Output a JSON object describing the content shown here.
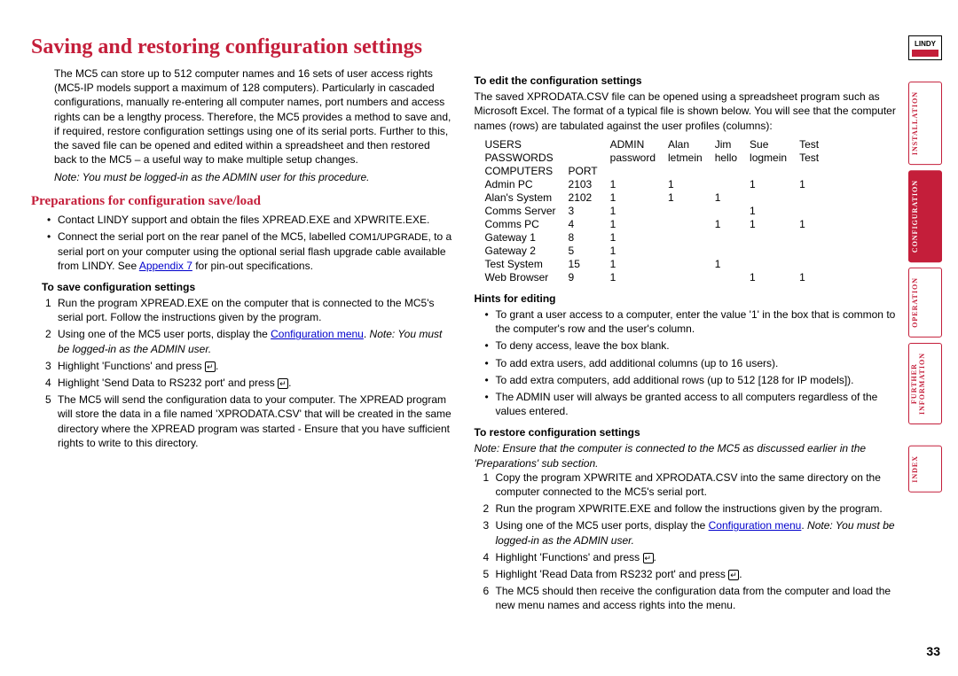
{
  "title": "Saving and restoring configuration settings",
  "intro": "The MC5 can store up to 512 computer names and 16 sets of user access rights (MC5-IP models support a maximum of 128 computers). Particularly in cascaded configurations, manually re-entering all computer names, port numbers and access rights can be a lengthy process. Therefore, the MC5 provides a method to save and, if required, restore configuration settings using one of its serial ports. Further to this, the saved file can be opened and edited within a spreadsheet and then restored back to the MC5 – a useful way to make multiple setup changes.",
  "intro_note": "Note: You must be logged-in as the ADMIN user for this procedure.",
  "prep_heading": "Preparations for configuration save/load",
  "prep_bullets": {
    "b1a": "Contact LINDY support and obtain the files XPREAD.EXE and XPWRITE.EXE.",
    "b2a": "Connect the serial port on the rear panel of the MC5, labelled ",
    "b2_small": "COM1/UPGRADE",
    "b2b": ", to a serial port on your computer using the optional serial flash upgrade cable available from LINDY. See ",
    "b2_link": "Appendix 7",
    "b2c": " for pin-out specifications."
  },
  "save_heading": "To save configuration settings",
  "save_steps": {
    "s1": "Run the program XPREAD.EXE on the computer that is connected to the MC5's serial port. Follow the instructions given by the program.",
    "s2a": "Using one of the MC5 user ports, display the ",
    "s2_link": "Configuration menu",
    "s2b": ". ",
    "s2_note": "Note: You must be logged-in as the ADMIN user.",
    "s3": "Highlight 'Functions' and press ",
    "s4": "Highlight 'Send Data to RS232 port' and press ",
    "s5": "The MC5 will send the configuration data to your computer. The XPREAD program will store the data in a file named 'XPRODATA.CSV' that will be created in the same directory where the XPREAD program was started - Ensure that you have sufficient rights to write to this directory."
  },
  "edit_heading": "To edit the configuration settings",
  "edit_intro": "The saved XPRODATA.CSV file can be opened using a spreadsheet program such as Microsoft Excel. The format of a typical file is shown below. You will see that the computer names (rows) are tabulated against the user profiles (columns):",
  "csv": {
    "headers": [
      "USERS",
      "",
      "ADMIN",
      "Alan",
      "Jim",
      "Sue",
      "Test"
    ],
    "pwrow": [
      "PASSWORDS",
      "",
      "password",
      "letmein",
      "hello",
      "logmein",
      "Test"
    ],
    "comprow": [
      "COMPUTERS",
      "PORT",
      "",
      "",
      "",
      "",
      ""
    ],
    "rows": [
      [
        "Admin PC",
        "2103",
        "1",
        "1",
        "",
        "1",
        "1"
      ],
      [
        "Alan's System",
        "2102",
        "1",
        "1",
        "1",
        "",
        ""
      ],
      [
        "Comms Server",
        "3",
        "1",
        "",
        "",
        "1",
        ""
      ],
      [
        "Comms PC",
        "4",
        "1",
        "",
        "1",
        "1",
        "1"
      ],
      [
        "Gateway 1",
        "8",
        "1",
        "",
        "",
        "",
        ""
      ],
      [
        "Gateway 2",
        "5",
        "1",
        "",
        "",
        "",
        ""
      ],
      [
        "Test System",
        "15",
        "1",
        "",
        "1",
        "",
        ""
      ],
      [
        "Web Browser",
        "9",
        "1",
        "",
        "",
        "1",
        "1"
      ]
    ]
  },
  "hints_heading": "Hints for editing",
  "hints": {
    "h1": "To grant a user access to a computer, enter the value '1' in the box that is common to the computer's row and the user's column.",
    "h2": "To deny access, leave the box blank.",
    "h3": "To add extra users, add additional columns (up to 16 users).",
    "h4": "To add extra computers, add additional rows (up to 512 [128 for IP models]).",
    "h5": "The ADMIN user will always be granted access to all computers regardless of the values entered."
  },
  "restore_heading": "To restore configuration settings",
  "restore_note": "Note: Ensure that the computer is connected to the MC5 as discussed earlier in the 'Preparations' sub section.",
  "restore_steps": {
    "r1": "Copy the program XPWRITE and XPRODATA.CSV into the same directory on the computer connected to the MC5's serial port.",
    "r2": "Run the program XPWRITE.EXE and follow the instructions given by the program.",
    "r3a": "Using one of the MC5 user ports, display the ",
    "r3_link": "Configuration menu",
    "r3b": ". ",
    "r3_note": "Note: You must be logged-in as the ADMIN user.",
    "r4": "Highlight 'Functions' and press ",
    "r5": "Highlight 'Read Data from RS232 port' and press ",
    "r6": "The MC5 should then receive the configuration data from the computer and load the new menu names and access rights into the menu."
  },
  "nav": {
    "logo": "LINDY",
    "tabs": {
      "t1": "INSTALLATION",
      "t2": "CONFIGURATION",
      "t3": "OPERATION",
      "t4a": "FURTHER",
      "t4b": "INFORMATION",
      "t5": "INDEX"
    }
  },
  "page_number": "33"
}
